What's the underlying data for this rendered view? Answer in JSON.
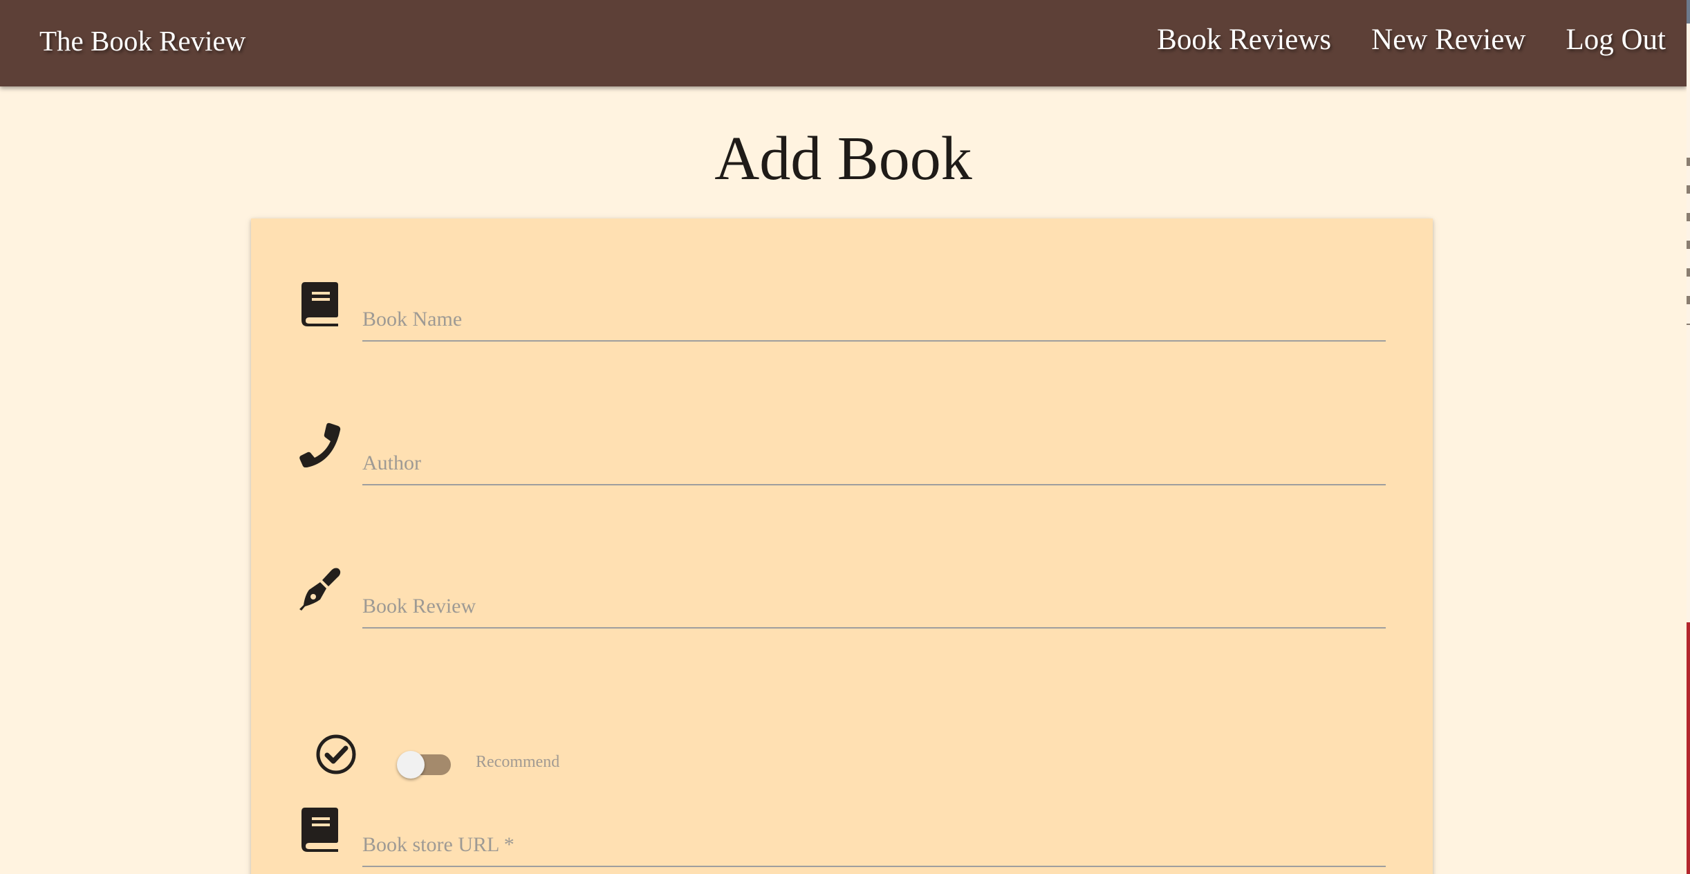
{
  "navbar": {
    "brand": "The Book Review",
    "links": [
      "Book Reviews",
      "New Review",
      "Log Out"
    ]
  },
  "page": {
    "title": "Add Book"
  },
  "form": {
    "book_name": {
      "placeholder": "Book Name",
      "icon": "book-icon"
    },
    "author": {
      "placeholder": "Author",
      "icon": "phone-icon"
    },
    "book_review": {
      "placeholder": "Book Review",
      "icon": "pen-icon"
    },
    "recommend": {
      "label": "Recommend",
      "icon": "check-circle-icon",
      "checked": false
    },
    "book_store_url": {
      "placeholder": "Book store URL *",
      "icon": "book-icon"
    }
  },
  "colors": {
    "navbar": "#5d4037",
    "background": "#fff3e0",
    "card": "#ffe0b2",
    "switch_track": "#a48a6c"
  }
}
